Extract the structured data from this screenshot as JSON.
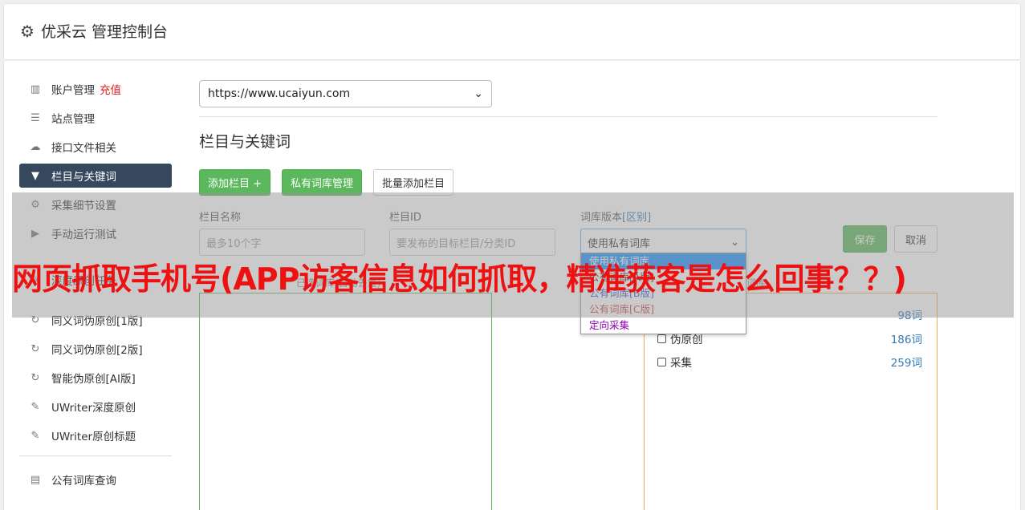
{
  "header": {
    "title": "优采云 管理控制台"
  },
  "sidebar": {
    "items": [
      {
        "label": "账户管理",
        "extra": "充值",
        "icon": "bar-chart-icon"
      },
      {
        "label": "站点管理",
        "icon": "server-icon"
      },
      {
        "label": "接口文件相关",
        "icon": "cloud-upload-icon"
      },
      {
        "label": "栏目与关键词",
        "icon": "filter-icon",
        "active": true
      },
      {
        "label": "采集细节设置",
        "icon": "gears-icon"
      },
      {
        "label": "手动运行测试",
        "icon": "play-circle-icon"
      },
      {
        "label": "深度原创任务",
        "icon": "edit-icon"
      },
      {
        "label": "同义词伪原创[1版]",
        "icon": "refresh-icon"
      },
      {
        "label": "同义词伪原创[2版]",
        "icon": "refresh-icon"
      },
      {
        "label": "智能伪原创[AI版]",
        "icon": "refresh-icon"
      },
      {
        "label": "UWriter深度原创",
        "icon": "edit-icon"
      },
      {
        "label": "UWriter原创标题",
        "icon": "edit-icon"
      },
      {
        "label": "公有词库查询",
        "icon": "book-icon"
      }
    ]
  },
  "main": {
    "site_select": "https://www.ucaiyun.com",
    "section_title": "栏目与关键词",
    "buttons": {
      "add_column": "添加栏目 +",
      "private_lib": "私有词库管理",
      "batch_add": "批量添加栏目"
    },
    "form": {
      "name_label": "栏目名称",
      "name_placeholder": "最多10个字",
      "id_label": "栏目ID",
      "id_placeholder": "要发布的目标栏目/分类ID",
      "lib_label": "词库版本",
      "lib_label_link": "[区别]",
      "lib_value": "使用私有词库",
      "save": "保存",
      "cancel": "取消"
    },
    "dropdown_options": [
      "使用私有词库",
      "公有词库[A版]",
      "公有词库[B版]",
      "公有词库[C版]",
      "定向采集"
    ],
    "dropdown_colors": [
      "#ffffff",
      "#333333",
      "#3355cc",
      "#cc4444",
      "#8800aa"
    ],
    "left_hint": "已选词库(自动去重)",
    "right_hint": "词库",
    "checkboxes": [
      {
        "label": "",
        "count": "98词"
      },
      {
        "label": "伪原创",
        "count": "186词"
      },
      {
        "label": "采集",
        "count": "259词"
      }
    ]
  },
  "overlay": {
    "text": "网页抓取手机号(APP访客信息如何抓取，精准获客是怎么回事？？)"
  },
  "colors": {
    "green": "#5cb85c",
    "nav_active": "#35485e",
    "red": "#ee1111",
    "orange": "#f0ad4e"
  }
}
